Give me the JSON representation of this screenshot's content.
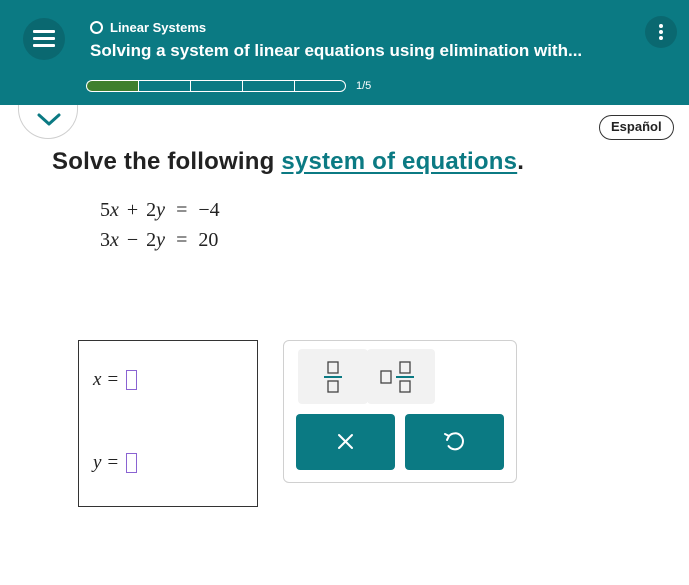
{
  "header": {
    "topic": "Linear Systems",
    "title": "Solving a system of linear equations using elimination with...",
    "progress_text": "1/5",
    "progress_fraction": 0.2,
    "progress_segments_total": 5,
    "progress_segments_filled": 1,
    "menu_icon": "hamburger-menu-icon",
    "more_icon": "vertical-ellipsis-icon"
  },
  "subbar": {
    "collapse_icon": "chevron-down-icon",
    "language_button": "Español"
  },
  "question": {
    "prefix": "Solve the following ",
    "link": "system of equations",
    "suffix": "."
  },
  "equations": [
    {
      "a": "5",
      "v1": "x",
      "op": "+",
      "b": "2",
      "v2": "y",
      "eq": "=",
      "rhs": "−4"
    },
    {
      "a": "3",
      "v1": "x",
      "op": "−",
      "b": "2",
      "v2": "y",
      "eq": "=",
      "rhs": "20"
    }
  ],
  "answer": {
    "x_label": "x",
    "y_label": "y",
    "equals": "="
  },
  "keypad": {
    "fraction_icon": "fraction-icon",
    "mixed_number_icon": "mixed-number-icon",
    "clear_icon": "close-icon",
    "undo_icon": "undo-icon"
  },
  "colors": {
    "header": "#0b7a83",
    "progress_filled": "#3f7f2e",
    "link": "#0b7a83",
    "input_border": "#8a63d2",
    "keypad_button": "#0b7a83"
  }
}
